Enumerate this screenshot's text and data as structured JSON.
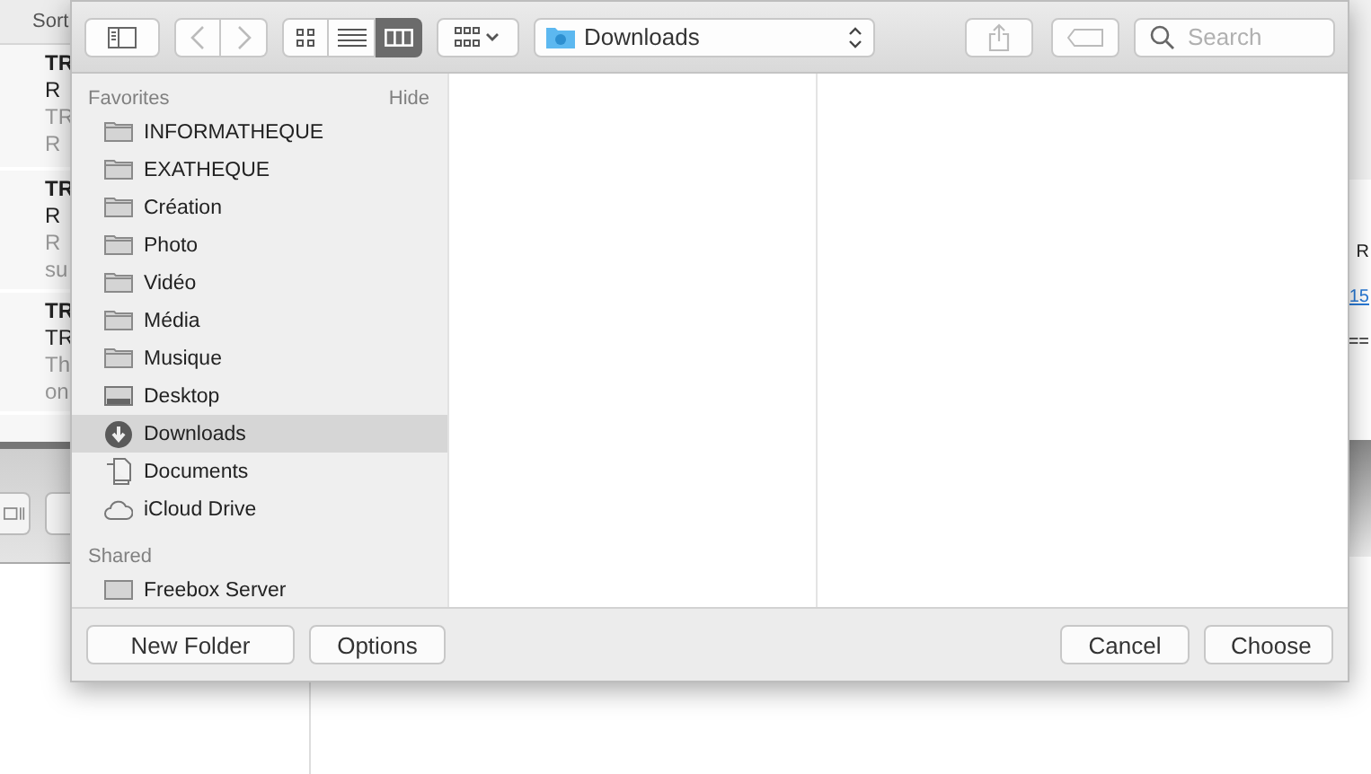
{
  "background_app": {
    "list_header": "Sort",
    "messages": [
      {
        "lines": [
          {
            "text": "TR",
            "kind": "title"
          },
          {
            "text": "R",
            "kind": "subject"
          },
          {
            "text": "TR",
            "kind": "preview"
          },
          {
            "text": "R",
            "kind": "preview"
          }
        ]
      },
      {
        "lines": [
          {
            "text": "TR",
            "kind": "title"
          },
          {
            "text": "R",
            "kind": "subject"
          },
          {
            "text": "R",
            "kind": "preview"
          },
          {
            "text": "su",
            "kind": "preview"
          }
        ]
      },
      {
        "lines": [
          {
            "text": "TR",
            "kind": "title"
          },
          {
            "text": "TR",
            "kind": "subject"
          },
          {
            "text": "Th",
            "kind": "preview"
          },
          {
            "text": "on",
            "kind": "preview"
          }
        ]
      }
    ],
    "right_fragments": [
      {
        "text": "R",
        "kind": "plain"
      },
      {
        "text": "15",
        "kind": "link"
      },
      {
        "text": "==",
        "kind": "plain"
      }
    ]
  },
  "dialog": {
    "toolbar": {
      "view_modes": [
        {
          "kind": "icons",
          "selected": false
        },
        {
          "kind": "list",
          "selected": false
        },
        {
          "kind": "columns",
          "selected": true
        }
      ],
      "location": "Downloads",
      "search": {
        "placeholder": "Search"
      }
    },
    "sidebar": {
      "sections": [
        {
          "title": "Favorites",
          "action": "Hide",
          "items": [
            {
              "label": "INFORMATHEQUE",
              "kind": "folder",
              "selected": false
            },
            {
              "label": "EXATHEQUE",
              "kind": "folder",
              "selected": false
            },
            {
              "label": "Création",
              "kind": "folder",
              "selected": false
            },
            {
              "label": "Photo",
              "kind": "folder",
              "selected": false
            },
            {
              "label": "Vidéo",
              "kind": "folder",
              "selected": false
            },
            {
              "label": "Média",
              "kind": "folder",
              "selected": false
            },
            {
              "label": "Musique",
              "kind": "folder",
              "selected": false
            },
            {
              "label": "Desktop",
              "kind": "desktop",
              "selected": false
            },
            {
              "label": "Downloads",
              "kind": "download",
              "selected": true
            },
            {
              "label": "Documents",
              "kind": "document",
              "selected": false
            },
            {
              "label": "iCloud Drive",
              "kind": "cloud",
              "selected": false
            }
          ]
        },
        {
          "title": "Shared",
          "items": [
            {
              "label": "Freebox Server",
              "kind": "server",
              "selected": false
            }
          ]
        }
      ]
    },
    "buttons_left": [
      "New Folder",
      "Options"
    ],
    "buttons_right": [
      "Cancel",
      "Choose"
    ]
  }
}
